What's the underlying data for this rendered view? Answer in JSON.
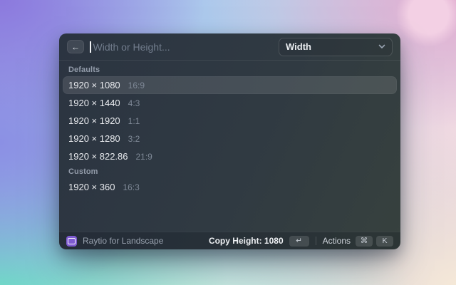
{
  "window": {
    "search": {
      "back_label": "←",
      "placeholder": "Width or Height..."
    },
    "dropdown": {
      "value": "Width"
    },
    "sections": [
      {
        "label": "Defaults",
        "items": [
          {
            "size": "1920 × 1080",
            "ratio": "16:9",
            "selected": true
          },
          {
            "size": "1920 × 1440",
            "ratio": "4:3",
            "selected": false
          },
          {
            "size": "1920 × 1920",
            "ratio": "1:1",
            "selected": false
          },
          {
            "size": "1920 × 1280",
            "ratio": "3:2",
            "selected": false
          },
          {
            "size": "1920 × 822.86",
            "ratio": "21:9",
            "selected": false
          }
        ]
      },
      {
        "label": "Custom",
        "items": [
          {
            "size": "1920 × 360",
            "ratio": "16:3",
            "selected": false
          }
        ]
      }
    ],
    "footer": {
      "app_icon": "aspect-ratio-icon",
      "app_name": "Raytio for Landscape",
      "primary_action": "Copy Height: 1080",
      "primary_key": "↵",
      "actions_label": "Actions",
      "actions_keys": [
        "⌘",
        "K"
      ]
    }
  },
  "colors": {
    "accent_purple": "#7e5bd0",
    "panel_dark": "#2e3842",
    "selection": "rgba(255,255,255,0.11)",
    "text_primary": "#e8eaee",
    "text_secondary": "#7f8997",
    "bg_gradient": [
      "#8c79de",
      "#b2d4ee",
      "#e2aed1",
      "#6edec5",
      "#f6ead7"
    ]
  }
}
